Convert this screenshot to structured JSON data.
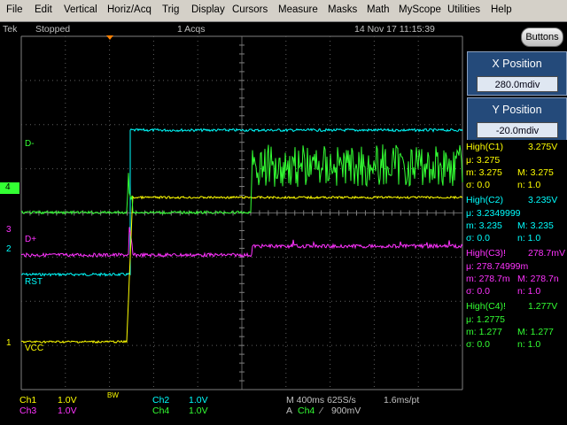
{
  "menu": [
    "File",
    "Edit",
    "Vertical",
    "Horiz/Acq",
    "Trig",
    "Display",
    "Cursors",
    "Measure",
    "Masks",
    "Math",
    "MyScope",
    "Utilities",
    "Help"
  ],
  "status": {
    "brand": "Tek",
    "state": "Stopped",
    "acqs": "1 Acqs",
    "timestamp": "14 Nov 17 11:15:39",
    "buttons_label": "Buttons"
  },
  "x_position": {
    "title": "X Position",
    "value": "280.0mdiv"
  },
  "y_position": {
    "title": "Y Position",
    "value": "-20.0mdiv"
  },
  "colors": {
    "ch1": "#ffff00",
    "ch2": "#00ffff",
    "ch3": "#ff33ff",
    "ch4": "#33ff33",
    "ref_red": "#ff3030"
  },
  "measurements": [
    {
      "header": "High(C1)",
      "value": "3.275V",
      "mu_label": "μ:",
      "mu": "3.275",
      "m": "m: 3.275",
      "M": "M: 3.275",
      "sigma": "σ: 0.0",
      "n": "n:  1.0",
      "color": "#ffff00"
    },
    {
      "header": "High(C2)",
      "value": "3.235V",
      "mu_label": "μ:",
      "mu": "3.2349999",
      "m": "m: 3.235",
      "M": "M: 3.235",
      "sigma": "σ: 0.0",
      "n": "n:  1.0",
      "color": "#00ffff"
    },
    {
      "header": "High(C3)!",
      "value": "278.7mV",
      "mu_label": "μ:",
      "mu": "278.74999m",
      "m": "m: 278.7m",
      "M": "M: 278.7n",
      "sigma": "σ: 0.0",
      "n": "n:  1.0",
      "color": "#ff33ff"
    },
    {
      "header": "High(C4)!",
      "value": "1.277V",
      "mu_label": "μ:",
      "mu": "1.2775",
      "m": "m: 1.277",
      "M": "M: 1.277",
      "sigma": "σ: 0.0",
      "n": "n:  1.0",
      "color": "#33ff33"
    }
  ],
  "waveform_labels": {
    "d_minus": "D-",
    "d_plus": "D+",
    "rst": "RST",
    "vcc": "VCC"
  },
  "channel_markers": [
    {
      "label": "4",
      "color": "#33ff33"
    },
    {
      "label": "3",
      "color": "#ff33ff"
    },
    {
      "label": "2",
      "color": "#00ffff"
    },
    {
      "label": "1",
      "color": "#ffff00"
    }
  ],
  "bottom": {
    "ch1_label": "Ch1",
    "ch1_scale": "1.0V",
    "ch2_label": "Ch2",
    "ch2_scale": "1.0V",
    "ch3_label": "Ch3",
    "ch3_scale": "1.0V",
    "ch4_label": "Ch4",
    "ch4_scale": "1.0V",
    "bw": "BW",
    "timebase": "M 400ms 625S/s",
    "resolution": "1.6ms/pt",
    "trigger_prefix": "A",
    "trigger_source": "Ch4",
    "trigger_slope": "⁄",
    "trigger_level": "900mV"
  }
}
